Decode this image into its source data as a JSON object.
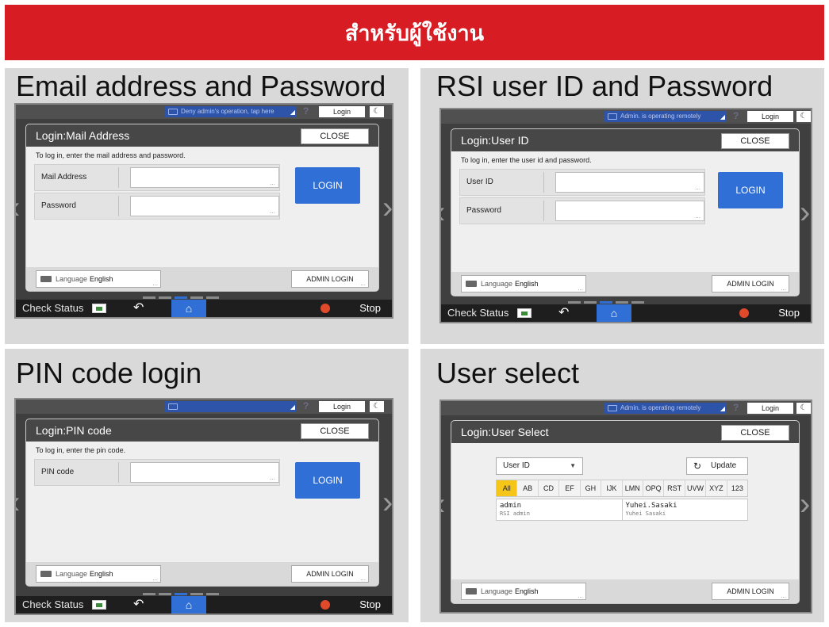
{
  "banner": {
    "title": "สำหรับผู้ใช้งาน"
  },
  "panels": {
    "email": {
      "heading": "Email address and Password",
      "notice": "Deny admin's operation, tap here",
      "login_top": "Login",
      "dialog_title": "Login:Mail Address",
      "close": "CLOSE",
      "instruction": "To log in, enter the mail address and password.",
      "field1_label": "Mail Address",
      "field2_label": "Password",
      "login_button": "LOGIN",
      "language_label": "Language",
      "language_value": "English",
      "admin_login": "ADMIN LOGIN",
      "check_status": "Check Status",
      "stop": "Stop"
    },
    "rsi": {
      "heading": "RSI user ID and Password",
      "notice": "Admin. is operating remotely",
      "login_top": "Login",
      "dialog_title": "Login:User ID",
      "close": "CLOSE",
      "instruction": "To log in, enter the user id and password.",
      "field1_label": "User ID",
      "field2_label": "Password",
      "login_button": "LOGIN",
      "language_label": "Language",
      "language_value": "English",
      "admin_login": "ADMIN LOGIN",
      "check_status": "Check Status",
      "stop": "Stop"
    },
    "pin": {
      "heading": "PIN code login",
      "notice": "",
      "login_top": "Login",
      "dialog_title": "Login:PIN code",
      "close": "CLOSE",
      "instruction": "To log in, enter the pin code.",
      "field1_label": "PIN code",
      "login_button": "LOGIN",
      "language_label": "Language",
      "language_value": "English",
      "admin_login": "ADMIN LOGIN",
      "check_status": "Check Status",
      "stop": "Stop"
    },
    "userselect": {
      "heading": "User select",
      "notice": "Admin. is operating remotely",
      "login_top": "Login",
      "dialog_title": "Login:User Select",
      "close": "CLOSE",
      "select_value": "User ID",
      "update": "Update",
      "alpha_tabs": [
        "All",
        "AB",
        "CD",
        "EF",
        "GH",
        "IJK",
        "LMN",
        "OPQ",
        "RST",
        "UVW",
        "XYZ",
        "123"
      ],
      "selected_tab": "All",
      "users": [
        {
          "name": "admin",
          "detail": "RSI admin"
        },
        {
          "name": "Yuhei.Sasaki",
          "detail": "Yuhei Sasaki"
        }
      ],
      "language_label": "Language",
      "language_value": "English",
      "admin_login": "ADMIN LOGIN"
    }
  },
  "colors": {
    "banner": "#d71c24",
    "login_blue": "#2f6fd6",
    "tab_selected": "#f5c518"
  }
}
